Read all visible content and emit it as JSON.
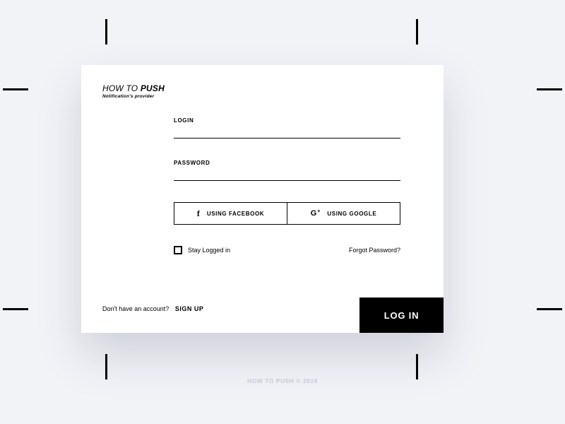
{
  "brand": {
    "title_pre": "HOW TO ",
    "title_bold": "PUSH",
    "subtitle": "Notification's provider"
  },
  "form": {
    "login_label": "LOGIN",
    "password_label": "PASSWORD",
    "facebook_label": "USING FACEBOOK",
    "google_label": "USING GOOGLE",
    "stay_logged_label": "Stay Logged in",
    "forgot_label": "Forgot Password?"
  },
  "signup": {
    "prompt": "Don't have an account?",
    "link": "SIGN UP"
  },
  "actions": {
    "login_button": "LOG IN"
  },
  "footer": {
    "text": "HOW TO PUSH © 2018"
  }
}
